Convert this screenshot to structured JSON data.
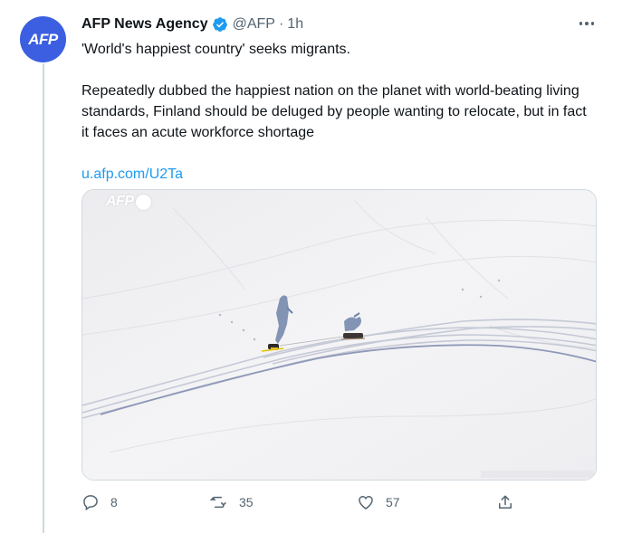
{
  "author": {
    "avatar_text": "AFP",
    "name": "AFP News Agency",
    "handle": "@AFP",
    "separator": "·",
    "time": "1h",
    "verified_icon": "verified-badge-icon"
  },
  "tweet": {
    "headline": "'World's happiest country' seeks migrants.",
    "body": "Repeatedly dubbed the happiest nation on the planet with world-beating living standards, Finland should be deluged by people wanting to relocate, but in fact it faces an acute workforce shortage",
    "link": "u.afp.com/U2Ta"
  },
  "media": {
    "watermark": "AFP",
    "description_colors": {
      "snow": "#f1f2f4",
      "shadow": "#6f82a8"
    }
  },
  "actions": {
    "reply_count": "8",
    "retweet_count": "35",
    "like_count": "57"
  },
  "colors": {
    "accent": "#1d9bf0",
    "avatar_bg": "#3b5fe0",
    "muted": "#536471"
  }
}
